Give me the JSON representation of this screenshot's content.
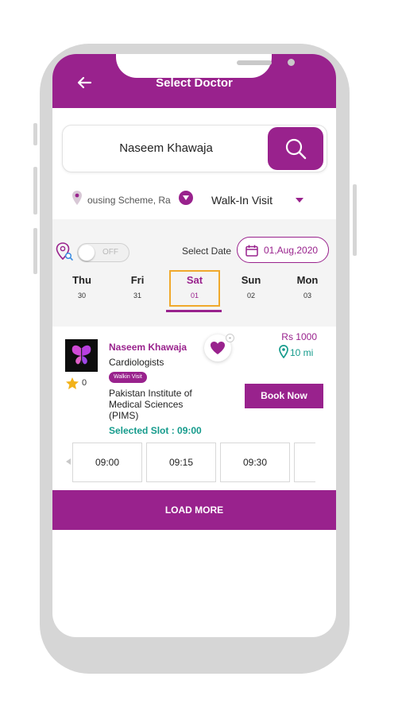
{
  "header": {
    "title": "Select Doctor",
    "back_icon": "arrow-left-icon"
  },
  "search": {
    "value": "Naseem Khawaja",
    "icon": "search-icon"
  },
  "location": {
    "text": "ousing Scheme, Ra",
    "icon": "location-pin-icon"
  },
  "visit_type": {
    "selected": "Walk-In Visit"
  },
  "filters": {
    "toggle_label": "OFF",
    "date_label": "Select Date",
    "date_value": "01,Aug,2020"
  },
  "days": [
    {
      "name": "Thu",
      "num": "30",
      "selected": false
    },
    {
      "name": "Fri",
      "num": "31",
      "selected": false
    },
    {
      "name": "Sat",
      "num": "01",
      "selected": true
    },
    {
      "name": "Sun",
      "num": "02",
      "selected": false
    },
    {
      "name": "Mon",
      "num": "03",
      "selected": false
    }
  ],
  "doctor": {
    "name": "Naseem Khawaja",
    "specialty": "Cardiologists",
    "badge": "Walkin Visit",
    "hospital": "Pakistan Institute of Medical Sciences (PIMS)",
    "rating": "0",
    "fee": "Rs 1000",
    "distance": "10 mi",
    "selected_slot": "Selected Slot : 09:00",
    "book_label": "Book Now",
    "favorite_badge": "-"
  },
  "slots": [
    "09:00",
    "09:15",
    "09:30",
    ""
  ],
  "load_more": "LOAD MORE",
  "colors": {
    "primary": "#99228d",
    "accent_green": "#159b8c",
    "highlight": "#f0a92c"
  }
}
